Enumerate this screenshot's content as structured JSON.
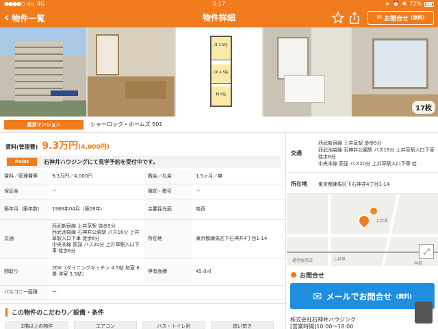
{
  "status": {
    "carrier": "au",
    "network": "4G",
    "time": "0:17",
    "battery": "72%"
  },
  "nav": {
    "back_label": "物件一覧",
    "title": "物件詳細",
    "contact_label": "お問合せ",
    "contact_sub": "(無料)"
  },
  "photos": {
    "count_label": "17枚",
    "plan_labels": [
      "洋 3.5帖",
      "DK 4.5帖",
      "和 6帖"
    ]
  },
  "header": {
    "type_badge": "賃貸マンション",
    "property_name": "シャーロック・ホームズ 501"
  },
  "rent": {
    "label": "賃料(管理費)",
    "value": "9.3万円",
    "fee": "(4,000円)"
  },
  "point": {
    "badge": "Point",
    "text": "石神井ハウジングにて見学予約を受付中です。"
  },
  "specs": [
    {
      "h1": "賃料／管理費等",
      "v1": "9.3万円／4,000円",
      "h2": "敷金／礼金",
      "v2": "1.5ヶ月／無"
    },
    {
      "h1": "保証金",
      "v1": "ー",
      "h2": "償却・敷引",
      "v2": "ー"
    },
    {
      "h1": "築年月（築年数）",
      "v1": "1988年04月（築28年）",
      "h2": "主要採光面",
      "v2": "南西"
    },
    {
      "h1": "交通",
      "v1": "西武新宿線 上井草駅 徒歩5分\n西武池袋線 石神井公園駅 バス16分 上井草駅入口下車 徒歩6分\n中央本線 荻窪 バス20分 上井草駅入口下車 徒歩6分",
      "h2": "所在地",
      "v2": "東京都練馬区下石神井4丁目1-14"
    },
    {
      "h1": "間取り",
      "v1": "2DK（ダイニングキッチン 4.5帖 和室 6畳 洋室 3.5帖）",
      "h2": "専有面積",
      "v2": "45.0㎡"
    },
    {
      "h1": "バルコニー面積",
      "v1": "ー",
      "h2": "",
      "v2": ""
    }
  ],
  "features": {
    "title": "この物件のこだわり／設備・条件",
    "tags": [
      "2階以上の物件",
      "エアコン",
      "バス・トイレ別",
      "追い焚き"
    ]
  },
  "side": {
    "access_label": "交通",
    "access_value": "西武新宿線 上井草駅 徒歩5分\n西武池袋線 石神井公園駅 バス16分 上井草駅入口下車 徒歩6分\n中央本線 荻窪 バス20分 上井草駅入口下車 徒",
    "address_label": "所在地",
    "address_value": "東京都練馬区下石神井4丁目1-14",
    "map_labels": [
      "上井草",
      "通信販売店",
      "井荻",
      "上井草"
    ],
    "inquiry_title": "お問合せ",
    "mail_label": "メールでお問合せ",
    "mail_sub": "(無料)",
    "company": "株式会社石神井ハウジング",
    "hours": "[営業時間]10:00～18:00"
  }
}
